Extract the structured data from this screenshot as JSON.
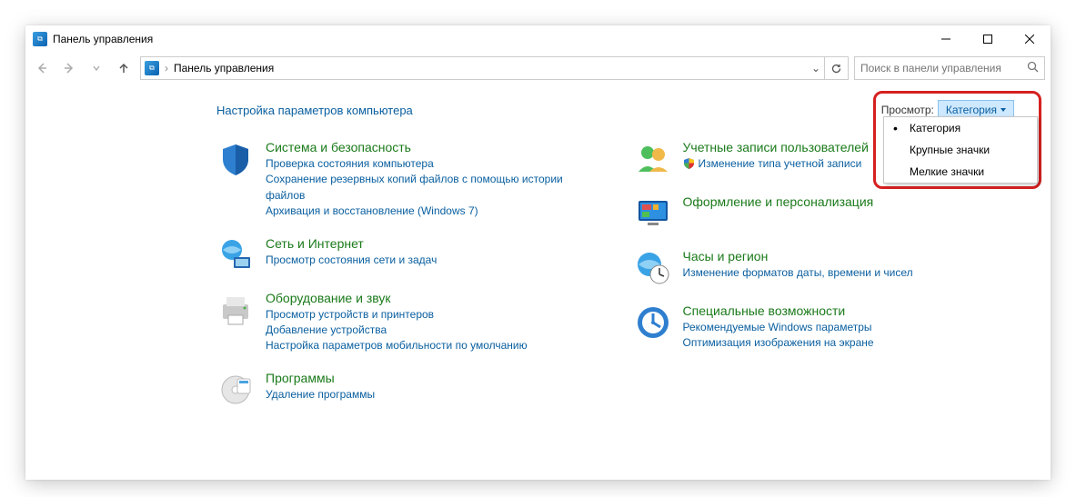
{
  "title": "Панель управления",
  "breadcrumb": "Панель управления",
  "search": {
    "placeholder": "Поиск в панели управления"
  },
  "heading": "Настройка параметров компьютера",
  "view": {
    "label": "Просмотр",
    "current": "Категория",
    "options": [
      "Категория",
      "Крупные значки",
      "Мелкие значки"
    ]
  },
  "left": [
    {
      "title": "Система и безопасность",
      "links": [
        "Проверка состояния компьютера",
        "Сохранение резервных копий файлов с помощью истории файлов",
        "Архивация и восстановление (Windows 7)"
      ]
    },
    {
      "title": "Сеть и Интернет",
      "links": [
        "Просмотр состояния сети и задач"
      ]
    },
    {
      "title": "Оборудование и звук",
      "links": [
        "Просмотр устройств и принтеров",
        "Добавление устройства",
        "Настройка параметров мобильности по умолчанию"
      ]
    },
    {
      "title": "Программы",
      "links": [
        "Удаление программы"
      ]
    }
  ],
  "right": [
    {
      "title": "Учетные записи пользователей",
      "links": [
        "Изменение типа учетной записи"
      ],
      "shieldLinks": [
        0
      ]
    },
    {
      "title": "Оформление и персонализация",
      "links": []
    },
    {
      "title": "Часы и регион",
      "links": [
        "Изменение форматов даты, времени и чисел"
      ]
    },
    {
      "title": "Специальные возможности",
      "links": [
        "Рекомендуемые Windows параметры",
        "Оптимизация изображения на экране"
      ]
    }
  ]
}
